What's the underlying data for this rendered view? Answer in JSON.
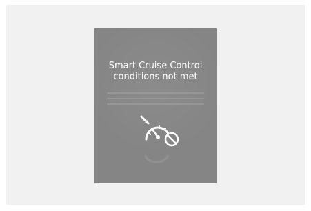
{
  "message": {
    "line1": "Smart Cruise Control",
    "line2": "conditions not met"
  },
  "icon": {
    "name": "cruise-control-unavailable-icon"
  },
  "colors": {
    "page_background": "#f1f1f1",
    "panel_background": "#858585",
    "text": "#ffffff"
  }
}
